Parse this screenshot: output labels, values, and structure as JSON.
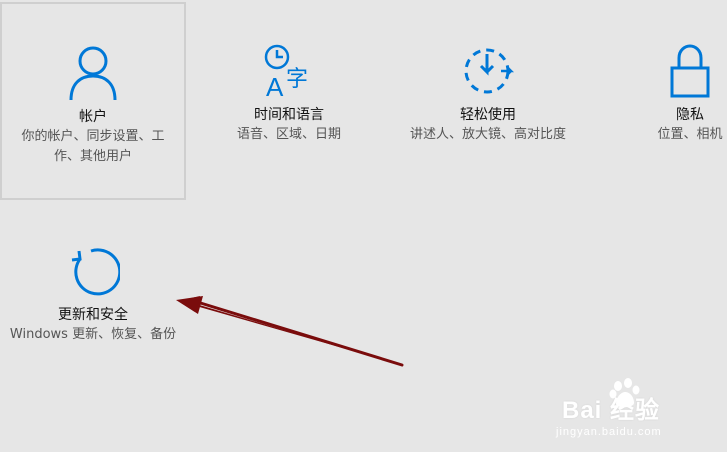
{
  "colors": {
    "accent": "#0078d7",
    "background": "#e6e6e6",
    "arrow": "#7a0c0c"
  },
  "tiles": [
    {
      "icon": "person-icon",
      "title": "帐户",
      "desc": "你的帐户、同步设置、工作、其他用户"
    },
    {
      "icon": "time-language-icon",
      "title": "时间和语言",
      "desc": "语音、区域、日期"
    },
    {
      "icon": "ease-of-access-icon",
      "title": "轻松使用",
      "desc": "讲述人、放大镜、高对比度"
    },
    {
      "icon": "lock-icon",
      "title": "隐私",
      "desc": "位置、相机"
    },
    {
      "icon": "update-sync-icon",
      "title": "更新和安全",
      "desc": "Windows 更新、恢复、备份"
    }
  ],
  "watermark": {
    "brand": "Bai  经验",
    "site": "jingyan.baidu.com"
  }
}
